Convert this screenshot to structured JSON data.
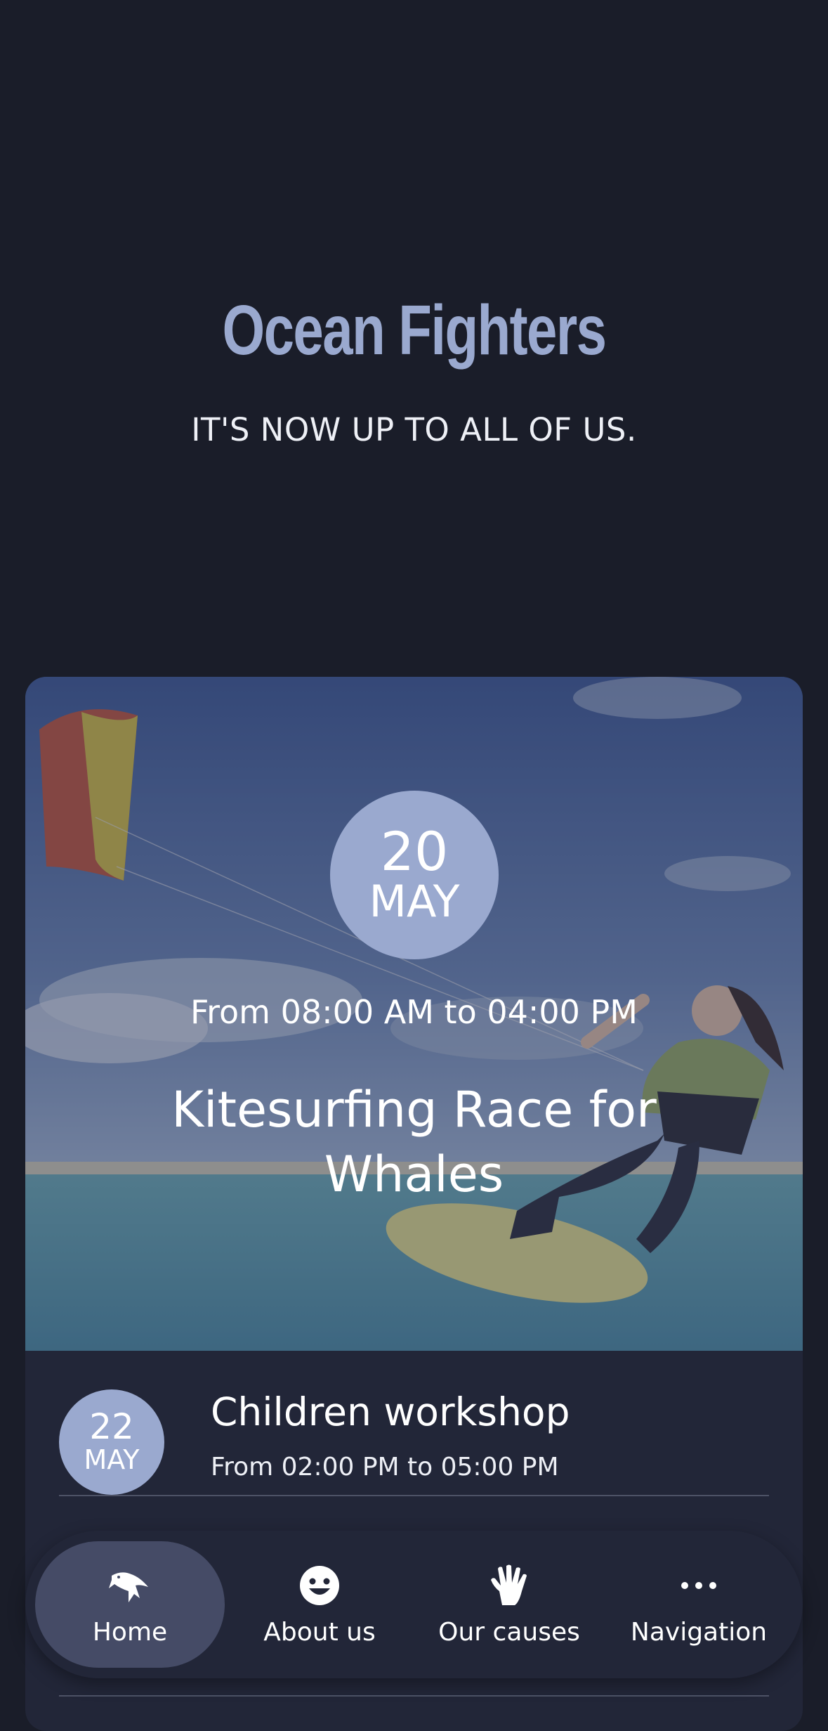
{
  "hero": {
    "title": "Ocean Fighters",
    "tagline": "IT'S NOW UP TO ALL OF US."
  },
  "featured_event": {
    "day": "20",
    "month": "MAY",
    "time": "From 08:00 AM to 04:00 PM",
    "title": "Kitesurfing Race for Whales"
  },
  "events": [
    {
      "day": "22",
      "month": "MAY",
      "title": "Children workshop",
      "time": "From 02:00 PM to 05:00 PM"
    }
  ],
  "nav": {
    "items": [
      {
        "label": "Home",
        "icon": "fish-icon",
        "active": true
      },
      {
        "label": "About us",
        "icon": "smiley-icon",
        "active": false
      },
      {
        "label": "Our causes",
        "icon": "hand-icon",
        "active": false
      },
      {
        "label": "Navigation",
        "icon": "more-dots-icon",
        "active": false
      }
    ]
  },
  "colors": {
    "background": "#1a1d29",
    "accent": "#9aa9cf",
    "card": "#222638",
    "nav_active": "#454b66"
  }
}
